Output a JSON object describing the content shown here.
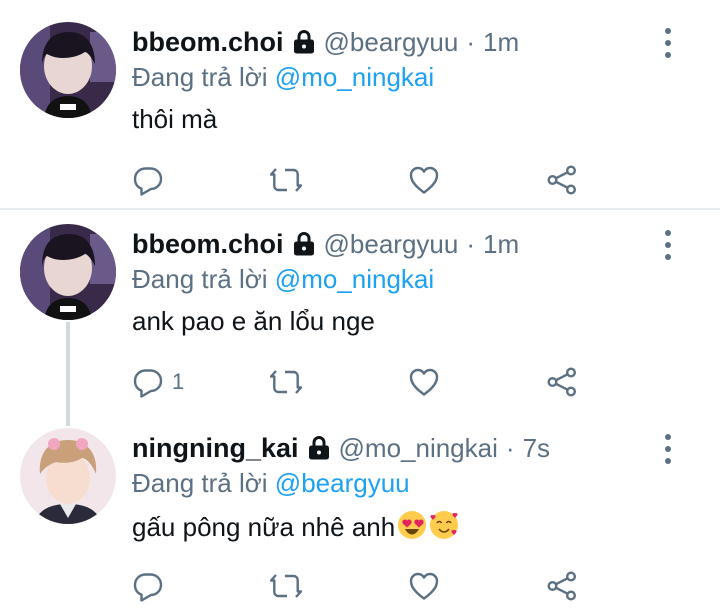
{
  "tweets": [
    {
      "name": "bbeom.choi",
      "handle": "@beargyuu",
      "separator": "·",
      "time": "1m",
      "reply_prefix": "Đang trả lời",
      "reply_to": "@mo_ningkai",
      "text": "thôi mà",
      "reply_count": ""
    },
    {
      "name": "bbeom.choi",
      "handle": "@beargyuu",
      "separator": "·",
      "time": "1m",
      "reply_prefix": "Đang trả lời",
      "reply_to": "@mo_ningkai",
      "text": "ank pao e ăn lổu nge",
      "reply_count": "1"
    },
    {
      "name": "ningning_kai",
      "handle": "@mo_ningkai",
      "separator": "·",
      "time": "7s",
      "reply_prefix": "Đang trả lời",
      "reply_to": "@beargyuu",
      "text": "gấu pông nữa nhê anh",
      "reply_count": ""
    }
  ],
  "colors": {
    "accent": "#1da1f2",
    "muted": "#5b7083",
    "text": "#0f1419",
    "divider": "#e6ecf0"
  },
  "icons": [
    "lock-icon",
    "more-icon",
    "reply-icon",
    "retweet-icon",
    "like-icon",
    "share-icon",
    "heart-eyes-emoji",
    "smiling-hearts-emoji"
  ]
}
